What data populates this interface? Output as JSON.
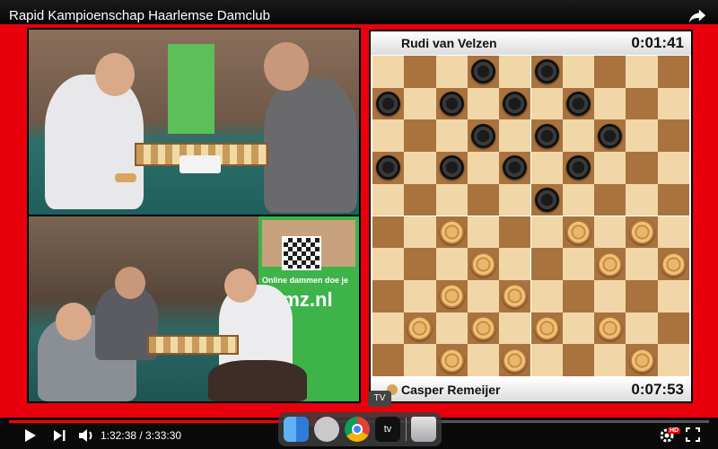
{
  "header": {
    "title": "Rapid Kampioenschap Haarlemse Damclub",
    "share_icon": "share-arrow-icon"
  },
  "camera_top": {
    "banner_text": ""
  },
  "camera_bottom": {
    "banner_slogan": "Online dammen doe je op",
    "banner_url": "lamz.nl"
  },
  "board": {
    "player_top": {
      "name": "Rudi van Velzen",
      "clock": "0:01:41"
    },
    "player_bottom": {
      "name": "Casper Remeijer",
      "clock": "0:07:53"
    },
    "black_pieces": [
      [
        0,
        3
      ],
      [
        0,
        5
      ],
      [
        1,
        0
      ],
      [
        1,
        2
      ],
      [
        1,
        4
      ],
      [
        1,
        6
      ],
      [
        2,
        3
      ],
      [
        2,
        5
      ],
      [
        2,
        7
      ],
      [
        3,
        0
      ],
      [
        3,
        2
      ],
      [
        3,
        4
      ],
      [
        3,
        6
      ],
      [
        4,
        5
      ]
    ],
    "white_pieces": [
      [
        5,
        2
      ],
      [
        5,
        6
      ],
      [
        5,
        8
      ],
      [
        6,
        3
      ],
      [
        6,
        7
      ],
      [
        6,
        9
      ],
      [
        7,
        2
      ],
      [
        7,
        4
      ],
      [
        8,
        1
      ],
      [
        8,
        3
      ],
      [
        8,
        5
      ],
      [
        8,
        7
      ],
      [
        9,
        2
      ],
      [
        9,
        4
      ],
      [
        9,
        8
      ]
    ],
    "colors": {
      "light": "#f1d7a8",
      "dark": "#a8733f",
      "frame": "#e8000c"
    }
  },
  "player_controls": {
    "time": "1:32:38 / 3:33:30",
    "progress_fraction": 0.433,
    "play_icon": "play-icon",
    "next_icon": "next-icon",
    "volume_icon": "volume-icon",
    "settings_icon": "gear-icon",
    "hd_badge": "HD",
    "fullscreen_icon": "fullscreen-icon"
  },
  "dock": {
    "tooltip": "TV",
    "apps": [
      "finder-icon",
      "launchpad-icon",
      "chrome-icon",
      "apple-tv-icon",
      "trash-icon"
    ],
    "tv_label": "tv"
  }
}
